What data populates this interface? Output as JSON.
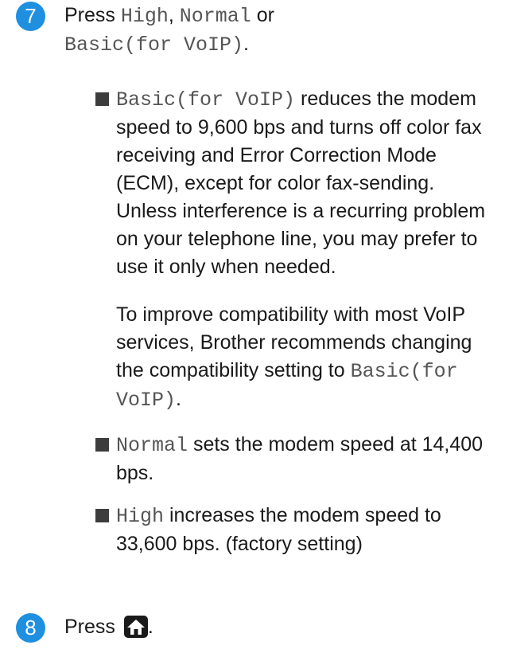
{
  "step7": {
    "number": "7",
    "press": "Press ",
    "opt_high": "High",
    "comma": ", ",
    "opt_normal": "Normal",
    "or": " or",
    "opt_basic": "Basic(for VoIP)",
    "period": "."
  },
  "bullet_basic": {
    "code": "Basic(for VoIP)",
    "text": " reduces the modem speed to 9,600 bps and turns off color fax receiving and Error Correction Mode (ECM), except for color fax-sending. Unless interference is a recurring problem on your telephone line, you may prefer to use it only when needed."
  },
  "note": {
    "text": "To improve compatibility with most VoIP services, Brother recommends changing the compatibility setting to ",
    "code": "Basic(for VoIP)",
    "period": "."
  },
  "bullet_normal": {
    "code": "Normal",
    "text": " sets the modem speed at 14,400 bps."
  },
  "bullet_high": {
    "code": "High",
    "text": " increases the modem speed to 33,600 bps. (factory setting)"
  },
  "step8": {
    "number": "8",
    "press": "Press ",
    "icon": "home-icon",
    "period": "."
  },
  "colors": {
    "badge": "#1f8fe0",
    "bullet": "#3d3d3d",
    "mono_text": "#555555"
  }
}
